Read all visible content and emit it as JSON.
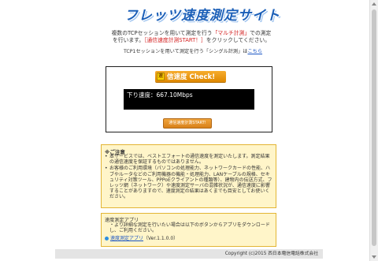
{
  "header": {
    "logo_text": "フレッツ速度測定サイト"
  },
  "intro": {
    "line1_pre": "複数のTCPセッションを用いて測定を行う",
    "line1_red": "「マルチ計測」",
    "line1_post": "での測定",
    "line2_pre": "を行います。",
    "line2_red": "［通信速度計測START！］",
    "line2_post": "をクリックしてください。"
  },
  "single": {
    "text": "TCP1セッションを用いて測定を行う「シングル計測」は",
    "link": "こちら"
  },
  "check": {
    "badge_icon_text": "速",
    "badge_label": "信速度 Check!",
    "result_text": "下り速度：667.10Mbps",
    "start_button": "通信速度計測START!"
  },
  "notice": {
    "title": "※ご注意",
    "items": [
      "本サービスでは、ベストエフォートの通信速度を測定いたします。測定結果の通信速度を保証するものではありません。",
      "お客様のご利用環境（パソコンの処理能力、ネットワークカードの性能、ハブやルータなどのご利用機器の機能・処理能力、LANケーブルの規格、セキュリティ対策ツール、PPPoEクライアントの種類等）、建物内の伝送方式、フレッツ網（ネットワーク）や速度測定サーバの混雑状況が、通信速度に影響することがありますので、速度測定の結果はあくまでも目安としてお使いください。"
    ]
  },
  "app": {
    "title": "速度測定アプリ",
    "desc": "・より詳細な測定を行いたい場合は以下のボタンからアプリをダウンロードし、ご利用ください。",
    "link": "速度測定アプリ",
    "version": "（Ver.1.1.0.0）"
  },
  "footer": {
    "copyright": "Copyright (c)2015 西日本電信電話株式会社"
  }
}
